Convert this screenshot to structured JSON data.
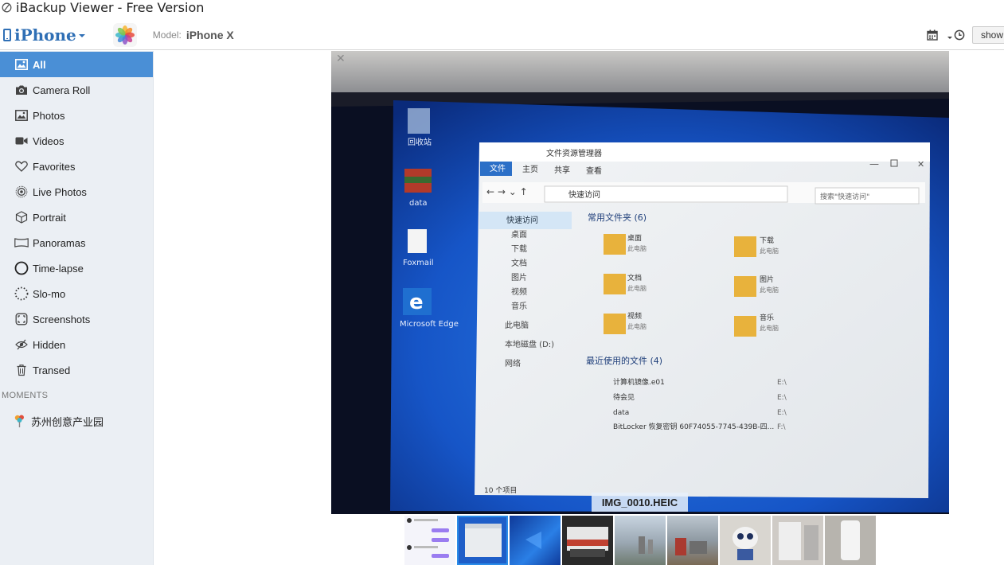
{
  "window": {
    "title": "iBackup Viewer - Free Version"
  },
  "toolbar": {
    "device_name": "iPhone",
    "model_label": "Model:",
    "model_value": "iPhone X",
    "show_label": "show"
  },
  "sidebar": {
    "items": [
      {
        "label": "All",
        "icon": "photo-icon"
      },
      {
        "label": "Camera Roll",
        "icon": "camera-icon"
      },
      {
        "label": "Photos",
        "icon": "photo-icon"
      },
      {
        "label": "Videos",
        "icon": "video-icon"
      },
      {
        "label": "Favorites",
        "icon": "heart-icon"
      },
      {
        "label": "Live Photos",
        "icon": "live-photo-icon"
      },
      {
        "label": "Portrait",
        "icon": "cube-icon"
      },
      {
        "label": "Panoramas",
        "icon": "panorama-icon"
      },
      {
        "label": "Time-lapse",
        "icon": "timelapse-icon"
      },
      {
        "label": "Slo-mo",
        "icon": "slomo-icon"
      },
      {
        "label": "Screenshots",
        "icon": "screenshot-icon"
      },
      {
        "label": "Hidden",
        "icon": "hidden-eye-icon"
      },
      {
        "label": "Transed",
        "icon": "trash-icon"
      }
    ],
    "moments_header": "MOMENTS",
    "moments": [
      {
        "label": "苏州创意产业园",
        "icon": "pin-icon"
      }
    ]
  },
  "viewer": {
    "filename": "IMG_0010.HEIC",
    "photo": {
      "desktop_icons": [
        "回收站",
        "data",
        "Foxmail",
        "Microsoft Edge"
      ],
      "explorer": {
        "title": "文件资源管理器",
        "ribbon_tabs": [
          "文件",
          "主页",
          "共享",
          "查看"
        ],
        "address": "快速访问",
        "search_placeholder": "搜索\"快速访问\"",
        "nav_items": [
          "快速访问",
          "桌面",
          "下载",
          "文档",
          "图片",
          "视频",
          "音乐",
          "此电脑",
          "本地磁盘 (D:)",
          "网络"
        ],
        "frequent_header": "常用文件夹 (6)",
        "folders": [
          {
            "name": "桌面",
            "sub": "此电脑"
          },
          {
            "name": "下载",
            "sub": "此电脑"
          },
          {
            "name": "文档",
            "sub": "此电脑"
          },
          {
            "name": "图片",
            "sub": "此电脑"
          },
          {
            "name": "视频",
            "sub": "此电脑"
          },
          {
            "name": "音乐",
            "sub": "此电脑"
          }
        ],
        "recent_header": "最近使用的文件 (4)",
        "recent": [
          {
            "name": "计算机镜像.e01",
            "path": "E:\\"
          },
          {
            "name": "待会见",
            "path": "E:\\"
          },
          {
            "name": "data",
            "path": "E:\\"
          },
          {
            "name": "BitLocker 恢复密钥 60F74055-7745-439B-四...",
            "path": "F:\\"
          }
        ],
        "status": "10 个项目"
      }
    }
  }
}
